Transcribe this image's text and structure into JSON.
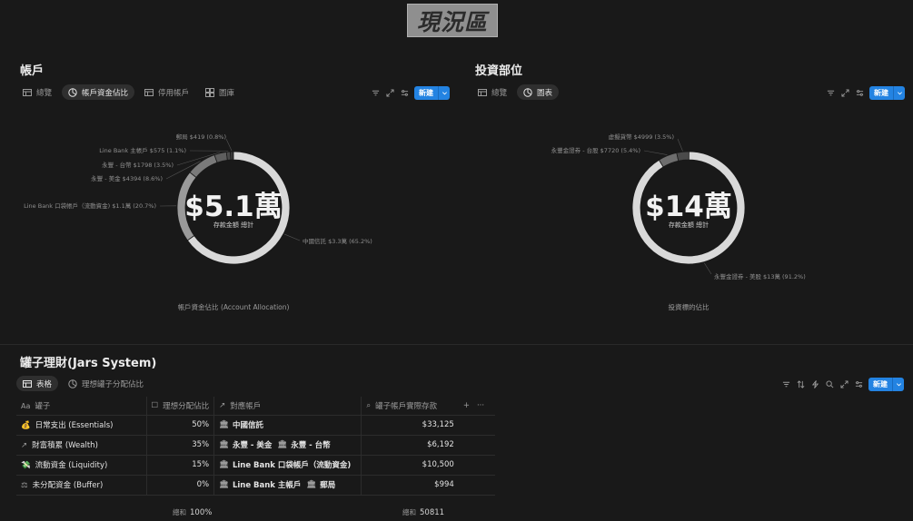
{
  "page_title": "現況區",
  "accounts": {
    "title": "帳戶",
    "tabs": [
      {
        "label": "總覽",
        "icon": "table-icon"
      },
      {
        "label": "帳戶資金佔比",
        "icon": "pie-icon"
      },
      {
        "label": "停用帳戶",
        "icon": "table-icon"
      },
      {
        "label": "圖庫",
        "icon": "gallery-icon"
      }
    ],
    "new_label": "新建",
    "chart_center_value": "$5.1萬",
    "chart_center_sub": "存款金額 總計",
    "chart_caption": "帳戶資金佔比 (Account Allocation)",
    "chart_data": {
      "type": "pie",
      "title": "帳戶資金佔比 (Account Allocation)",
      "slices": [
        {
          "label": "中國信託 $3.3萬 (65.2%)",
          "percent": 65.2,
          "color": "#d9d9d9"
        },
        {
          "label": "Line Bank 口袋帳戶（流動資金) $1.1萬 (20.7%)",
          "percent": 20.7,
          "color": "#9a9a9a"
        },
        {
          "label": "永豐 - 美金 $4394 (8.6%)",
          "percent": 8.6,
          "color": "#7a7a7a"
        },
        {
          "label": "永豐 - 台幣 $1798 (3.5%)",
          "percent": 3.5,
          "color": "#5e5e5e"
        },
        {
          "label": "Line Bank 主帳戶 $575 (1.1%)",
          "percent": 1.1,
          "color": "#4a4a4a"
        },
        {
          "label": "郵局 $419 (0.8%)",
          "percent": 0.8,
          "color": "#3a3a3a"
        }
      ]
    }
  },
  "investments": {
    "title": "投資部位",
    "tabs": [
      {
        "label": "總覽",
        "icon": "table-icon"
      },
      {
        "label": "圖表",
        "icon": "pie-icon"
      }
    ],
    "new_label": "新建",
    "chart_center_value": "$14萬",
    "chart_center_sub": "存款金額 總計",
    "chart_caption": "投資標的佔比",
    "chart_data": {
      "type": "pie",
      "title": "投資標的佔比",
      "slices": [
        {
          "label": "永豐金證券 - 美股 $13萬 (91.2%)",
          "percent": 91.2,
          "color": "#d9d9d9"
        },
        {
          "label": "永豐金證券 - 台股 $7720 (5.4%)",
          "percent": 5.4,
          "color": "#6e6e6e"
        },
        {
          "label": "虛擬貨幣 $4999 (3.5%)",
          "percent": 3.5,
          "color": "#4a4a4a"
        }
      ]
    }
  },
  "jars": {
    "title": "罐子理財(Jars System)",
    "tabs": [
      {
        "label": "表格",
        "icon": "table-icon"
      },
      {
        "label": "理想罐子分配佔比",
        "icon": "pie-icon"
      }
    ],
    "new_label": "新建",
    "columns": [
      "罐子",
      "理想分配佔比",
      "對應帳戶",
      "罐子帳戶實際存款"
    ],
    "rows": [
      {
        "name": "日常支出 (Essentials)",
        "icon": "money-bag-icon",
        "ratio": "50%",
        "accounts": [
          "中國信託"
        ],
        "amount": "$33,125"
      },
      {
        "name": "財富積累 (Wealth)",
        "icon": "chart-up-icon",
        "ratio": "35%",
        "accounts": [
          "永豐 - 美金",
          "永豐 - 台幣"
        ],
        "amount": "$6,192"
      },
      {
        "name": "流動資金 (Liquidity)",
        "icon": "flying-money-icon",
        "ratio": "15%",
        "accounts": [
          "Line Bank 口袋帳戶（流動資金)"
        ],
        "amount": "$10,500"
      },
      {
        "name": "未分配資金 (Buffer)",
        "icon": "scale-icon",
        "ratio": "0%",
        "accounts": [
          "Line Bank 主帳戶",
          "郵局"
        ],
        "amount": "$994"
      }
    ],
    "footer": {
      "sum_label": "總和",
      "sum_ratio": "100%",
      "sum_label2": "總和",
      "sum_amount": "50811"
    }
  }
}
